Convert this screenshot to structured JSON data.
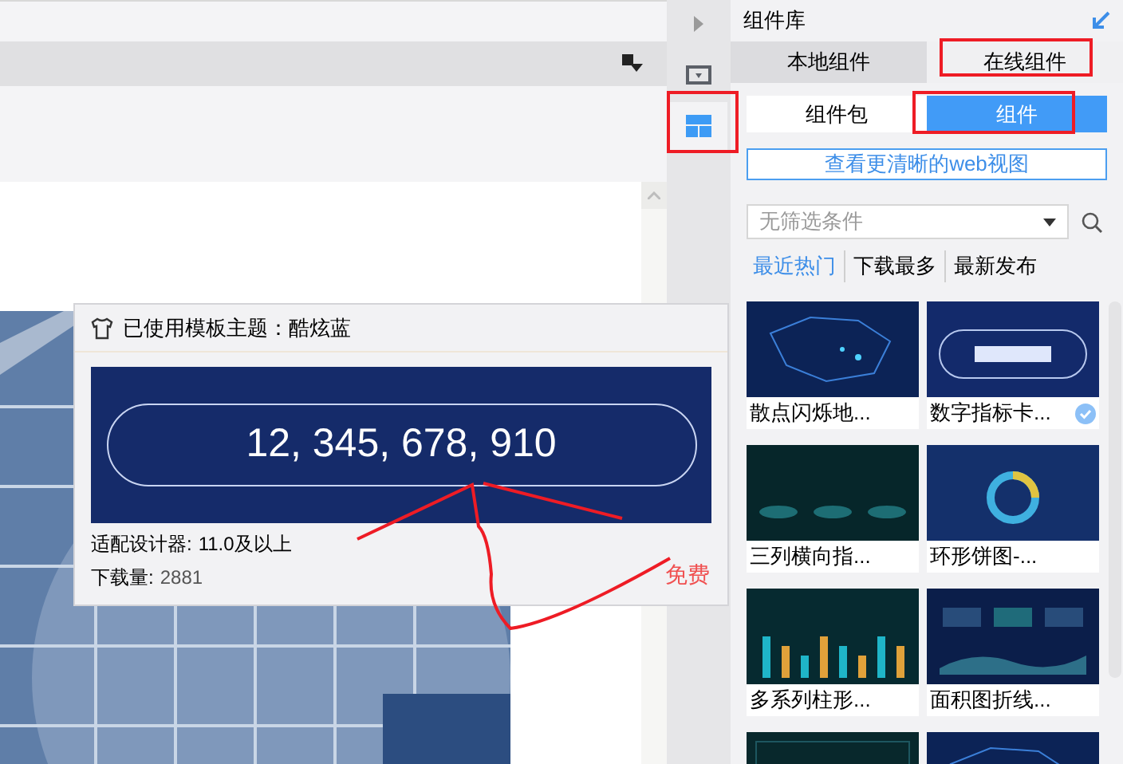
{
  "side_strip": [
    {
      "kind": "expand",
      "selected": false
    },
    {
      "kind": "dropdown",
      "selected": false
    },
    {
      "kind": "layout",
      "selected": true
    }
  ],
  "panel": {
    "title": "组件库",
    "tabs": [
      {
        "label": "本地组件",
        "selected": false
      },
      {
        "label": "在线组件",
        "selected": true
      }
    ],
    "subtabs": [
      {
        "label": "组件包",
        "selected": false
      },
      {
        "label": "组件",
        "selected": true
      }
    ],
    "web_view_button": "查看更清晰的web视图",
    "filter": {
      "placeholder": "无筛选条件"
    },
    "sort_tabs": [
      {
        "label": "最近热门",
        "selected": true
      },
      {
        "label": "下载最多",
        "selected": false
      },
      {
        "label": "最新发布",
        "selected": false
      }
    ],
    "cards": [
      {
        "kind": "map",
        "name": "散点闪烁地...",
        "checked": false
      },
      {
        "kind": "number",
        "name": "数字指标卡...",
        "checked": true
      },
      {
        "kind": "columns",
        "name": "三列横向指...",
        "checked": false
      },
      {
        "kind": "donut",
        "name": "环形饼图-...",
        "checked": false
      },
      {
        "kind": "bars",
        "name": "多系列柱形...",
        "checked": false
      },
      {
        "kind": "area",
        "name": "面积图折线...",
        "checked": false
      },
      {
        "kind": "dark"
      },
      {
        "kind": "map"
      }
    ]
  },
  "popup": {
    "theme_label": "已使用模板主题：酷炫蓝",
    "preview_value": "12, 345, 678, 910",
    "compat_label": "适配设计器:",
    "compat_value": "11.0及以上",
    "downloads_label": "下载量:",
    "downloads_value": "2881",
    "price": "免费"
  }
}
